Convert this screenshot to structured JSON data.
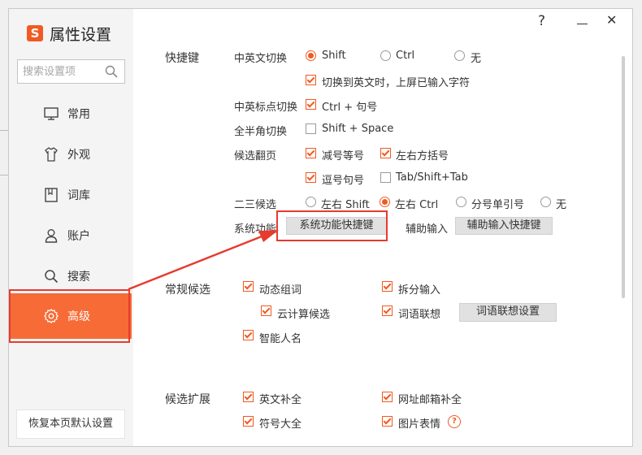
{
  "window": {
    "app_title": "属性设置",
    "logo_glyph": "S",
    "help_label": "?",
    "close_label": "✕"
  },
  "sidebar": {
    "search_placeholder": "搜索设置项",
    "items": [
      {
        "label": "常用",
        "icon": "monitor-icon"
      },
      {
        "label": "外观",
        "icon": "shirt-icon"
      },
      {
        "label": "词库",
        "icon": "book-icon"
      },
      {
        "label": "账户",
        "icon": "user-icon"
      },
      {
        "label": "搜索",
        "icon": "search-icon"
      },
      {
        "label": "高级",
        "icon": "gear-icon",
        "active": true
      }
    ],
    "restore_label": "恢复本页默认设置"
  },
  "shortcuts": {
    "section_title": "快捷键",
    "cn_en_switch": {
      "label": "中英文切换",
      "options": [
        "Shift",
        "Ctrl",
        "无"
      ],
      "selected": "Shift",
      "commit_label": "切换到英文时，上屏已输入字符",
      "commit_checked": true
    },
    "punct_switch": {
      "label": "中英标点切换",
      "option": "Ctrl + 句号",
      "checked": true
    },
    "fullwidth_switch": {
      "label": "全半角切换",
      "option": "Shift + Space",
      "checked": false
    },
    "paging": {
      "label": "候选翻页",
      "options": [
        {
          "label": "减号等号",
          "checked": true
        },
        {
          "label": "左右方括号",
          "checked": true
        },
        {
          "label": "逗号句号",
          "checked": true
        },
        {
          "label": "Tab/Shift+Tab",
          "checked": false
        }
      ]
    },
    "second_third": {
      "label": "二三候选",
      "options": [
        "左右 Shift",
        "左右 Ctrl",
        "分号单引号",
        "无"
      ],
      "selected": "左右 Ctrl"
    },
    "system": {
      "label": "系统功能",
      "button": "系统功能快捷键"
    },
    "aux": {
      "label": "辅助输入",
      "button": "辅助输入快捷键"
    }
  },
  "normal_candidates": {
    "section_title": "常规候选",
    "items": [
      {
        "label": "动态组词",
        "checked": true
      },
      {
        "label": "拆分输入",
        "checked": true
      },
      {
        "label": "云计算候选",
        "checked": true
      },
      {
        "label": "词语联想",
        "checked": true
      },
      {
        "label": "智能人名",
        "checked": true
      }
    ],
    "assoc_button": "词语联想设置"
  },
  "candidate_ext": {
    "section_title": "候选扩展",
    "items": [
      {
        "label": "英文补全",
        "checked": true
      },
      {
        "label": "网址邮箱补全",
        "checked": true
      },
      {
        "label": "符号大全",
        "checked": true
      },
      {
        "label": "图片表情",
        "checked": true
      }
    ],
    "info_glyph": "?"
  },
  "colors": {
    "accent": "#f05a22",
    "active_nav": "#f76b36",
    "annotation_red": "#e63b2e"
  }
}
